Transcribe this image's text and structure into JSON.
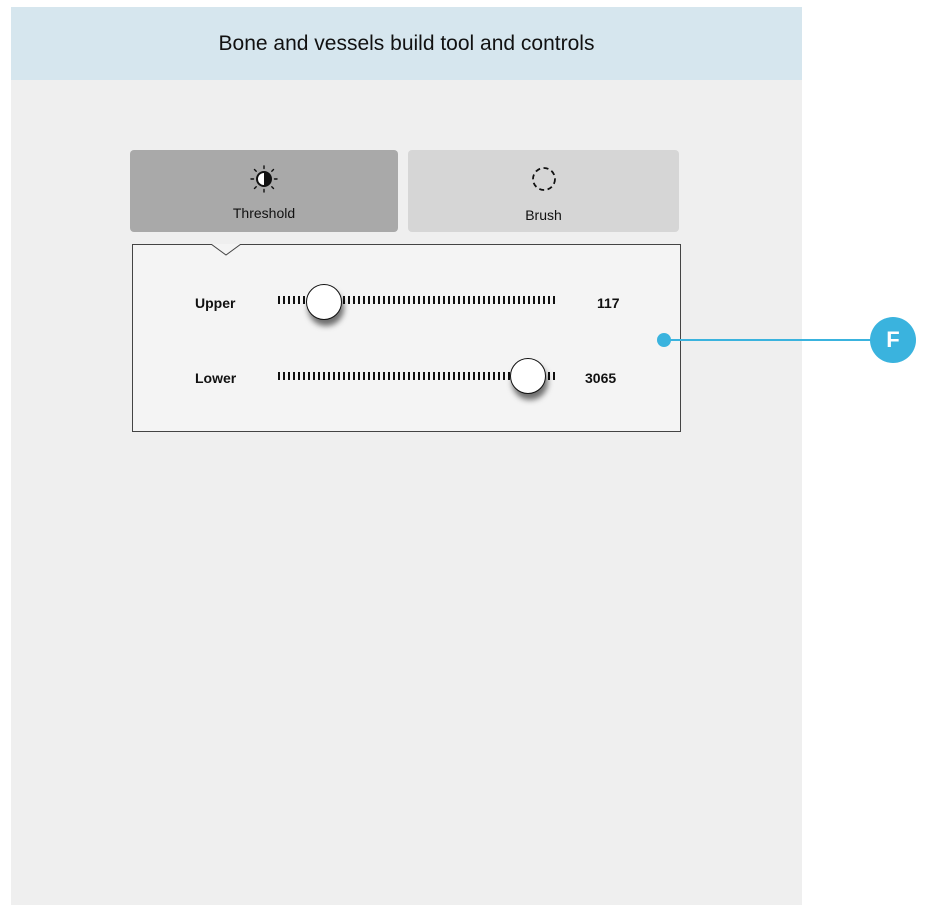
{
  "header": {
    "title": "Bone and vessels build tool and controls"
  },
  "tabs": [
    {
      "label": "Threshold",
      "icon": "contrast-icon",
      "selected": true
    },
    {
      "label": "Brush",
      "icon": "dashed-circle-icon",
      "selected": false
    }
  ],
  "sliders": {
    "upper": {
      "label": "Upper",
      "value": "117",
      "level": 0.16
    },
    "lower": {
      "label": "Lower",
      "value": "3065",
      "level": 0.89
    }
  },
  "callout": {
    "letter": "F",
    "color": "#3ab3de"
  }
}
